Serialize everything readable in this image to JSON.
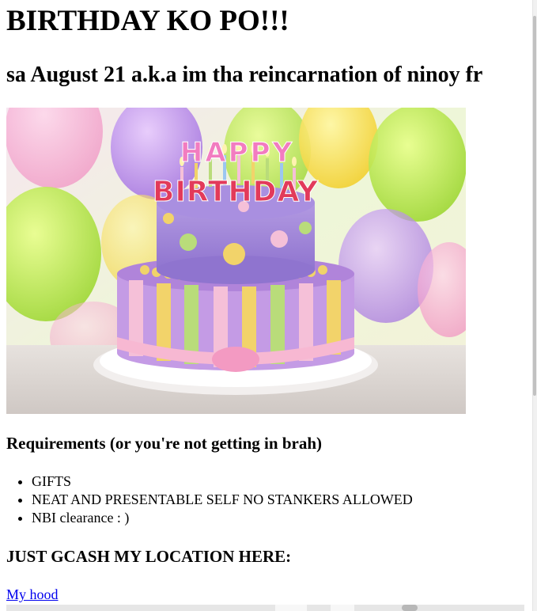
{
  "page": {
    "title": "BIRTHDAY KO PO!!!",
    "subtitle": "sa August 21 a.k.a im tha reincarnation of ninoy fr"
  },
  "image": {
    "alt": "Birthday cake",
    "topper_line1": "HAPPY",
    "topper_line2": "BIRTHDAY"
  },
  "requirements": {
    "heading": "Requirements (or you're not getting in brah)",
    "items": [
      "GIFTS",
      "NEAT AND PRESENTABLE SELF NO STANKERS ALLOWED",
      "NBI clearance : )"
    ]
  },
  "location": {
    "heading": "JUST GCASH MY LOCATION HERE:",
    "link_text": "My hood"
  },
  "colors": {
    "link": "#0000ee",
    "text": "#000000",
    "background": "#ffffff"
  }
}
